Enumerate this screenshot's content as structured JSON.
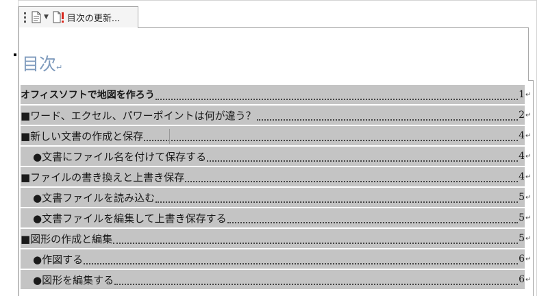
{
  "content_control": {
    "update_label": "目次の更新...",
    "icons": {
      "grip": "grip-icon",
      "doc": "document-icon",
      "caret": "caret-down-icon",
      "update": "update-table-icon"
    }
  },
  "toc": {
    "heading": "目次",
    "paragraph_mark": "↵",
    "highlight_color": "#c4c4c4",
    "heading_color": "#7f9bbd",
    "entries": [
      {
        "text": "オフィスソフトで地図を作ろう",
        "page": "1"
      },
      {
        "text": "■ワード、エクセル、パワーポイントは何が違う？",
        "page": "2"
      },
      {
        "text": "■新しい文書の作成と保存",
        "page": "4"
      },
      {
        "text": "●文書にファイル名を付けて保存する",
        "page": "4"
      },
      {
        "text": "■ファイルの書き換えと上書き保存",
        "page": "4"
      },
      {
        "text": "●文書ファイルを読み込む",
        "page": "5"
      },
      {
        "text": "●文書ファイルを編集して上書き保存する",
        "page": "5"
      },
      {
        "text": "■図形の作成と編集",
        "page": "5"
      },
      {
        "text": "●作図する",
        "page": "6"
      },
      {
        "text": "●図形を編集する",
        "page": "6"
      }
    ]
  }
}
